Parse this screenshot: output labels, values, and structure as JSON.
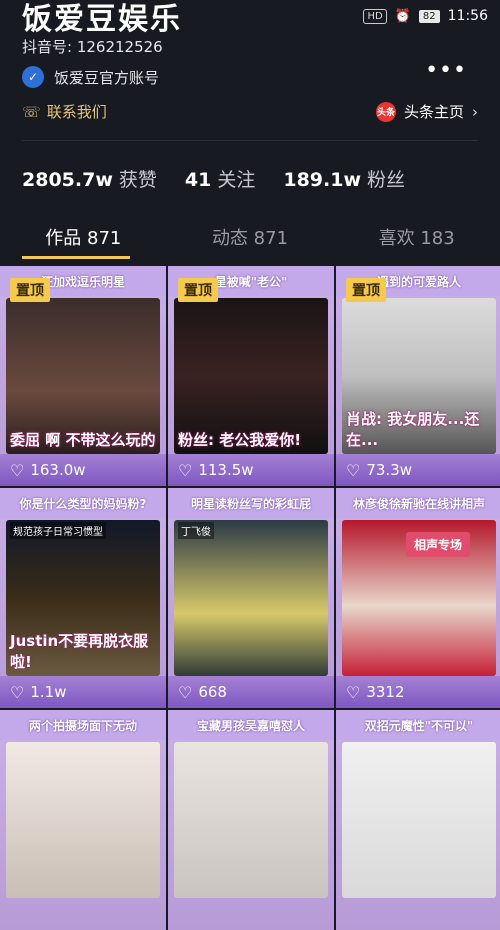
{
  "status": {
    "badge": "HD",
    "battery": "82",
    "time": "11:56"
  },
  "profile": {
    "title": "饭爱豆娱乐",
    "douyin_id": "抖音号: 126212526",
    "official": "饭爱豆官方账号",
    "contact": "联系我们",
    "toutiao": "头条主页"
  },
  "stats": [
    {
      "num": "2805.7w",
      "label": "获赞"
    },
    {
      "num": "41",
      "label": "关注"
    },
    {
      "num": "189.1w",
      "label": "粉丝"
    }
  ],
  "tabs": [
    {
      "label": "作品 871"
    },
    {
      "label": "动态 871"
    },
    {
      "label": "喜欢 183"
    }
  ],
  "pin_label": "置顶",
  "videos": [
    {
      "banner": "狂加戏逗乐明星",
      "caption": "委屈 啊 不带这么玩的",
      "likes": "163.0w"
    },
    {
      "banner": "星被喊\"老公\"",
      "caption": "粉丝: 老公我爱你!",
      "likes": "113.5w"
    },
    {
      "banner": "遇到的可爱路人",
      "caption": "肖战: 我女朋友...还在...",
      "likes": "73.3w"
    },
    {
      "banner": "你是什么类型的妈妈粉?",
      "caption": "Justin不要再脱衣服啦!",
      "likes": "1.1w"
    },
    {
      "banner": "明星读粉丝写的彩虹屁",
      "caption": "",
      "likes": "668"
    },
    {
      "banner": "林彦俊徐新驰在线讲相声",
      "caption": "",
      "likes": "3312"
    },
    {
      "banner": "两个拍摄场面下无动",
      "caption": "",
      "likes": ""
    },
    {
      "banner": "宝藏男孩吴嘉嘻怼人",
      "caption": "",
      "likes": ""
    },
    {
      "banner": "双招元魔性\"不可以\"",
      "caption": "",
      "likes": ""
    }
  ],
  "small_tags": {
    "v4": "规范孩子日常习惯型",
    "v5": "丁飞俊",
    "v6": "相声专场"
  }
}
